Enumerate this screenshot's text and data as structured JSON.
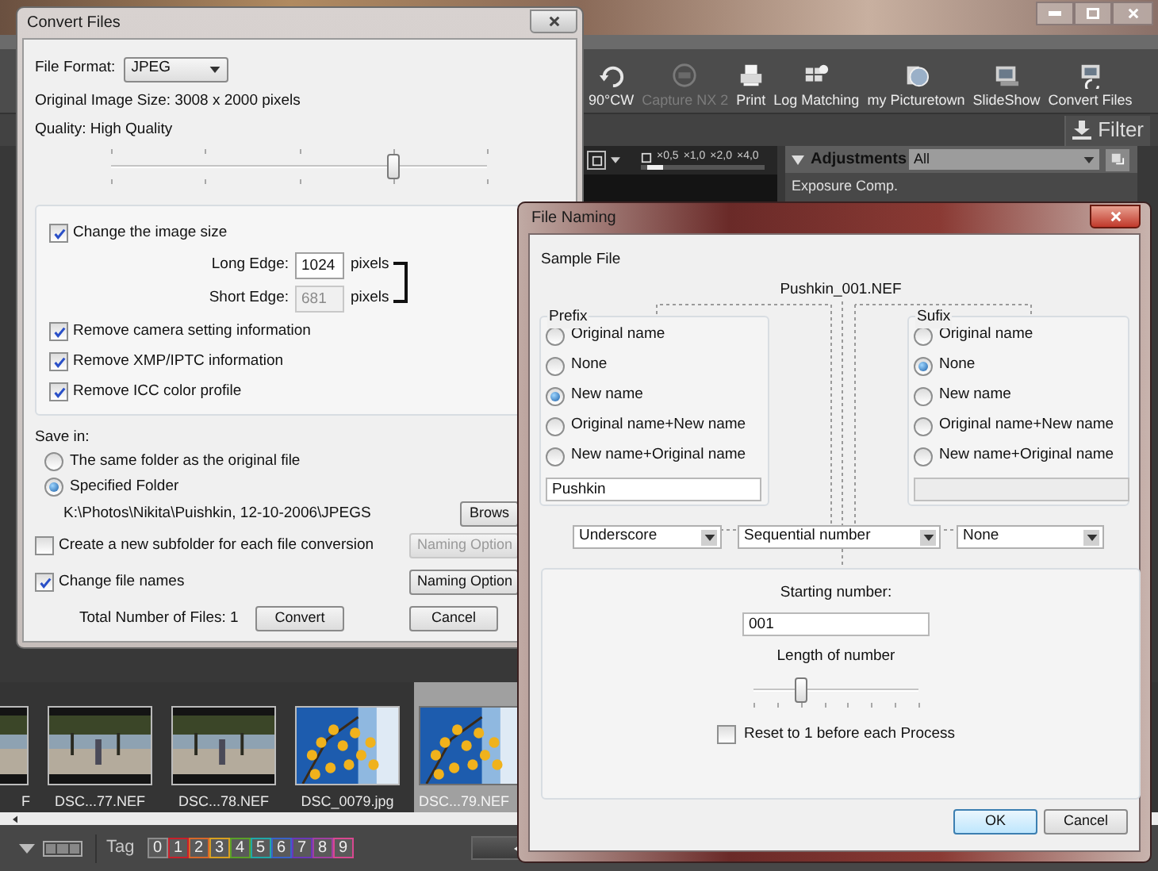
{
  "app": {
    "toolbar": [
      {
        "label": "90°CW",
        "disabled": false
      },
      {
        "label": "Capture NX 2",
        "disabled": true
      },
      {
        "label": "Print",
        "disabled": false
      },
      {
        "label": "Log Matching",
        "disabled": false
      },
      {
        "label": "my Picturetown",
        "disabled": false
      },
      {
        "label": "SlideShow",
        "disabled": false
      },
      {
        "label": "Convert Files",
        "disabled": false
      }
    ],
    "filter_button": "Filter",
    "zoom": {
      "labels": [
        "×0,5",
        "×1,0",
        "×2,0",
        "×4,0"
      ],
      "level": 0.05
    },
    "adjustments": {
      "title": "Adjustments",
      "filter": "All",
      "items": [
        "Exposure Comp."
      ]
    },
    "thumbnails": [
      {
        "caption": "F",
        "selected": false
      },
      {
        "caption": "DSC...77.NEF",
        "selected": false
      },
      {
        "caption": "DSC...78.NEF",
        "selected": false
      },
      {
        "caption": "DSC_0079.jpg",
        "selected": false
      },
      {
        "caption": "DSC...79.NEF",
        "selected": true
      }
    ],
    "tag_label": "Tag",
    "tags": [
      {
        "label": "0",
        "color": "#8c8c8c"
      },
      {
        "label": "1",
        "color": "#c8202a"
      },
      {
        "label": "2",
        "color": "#d8682a"
      },
      {
        "label": "3",
        "color": "#d8a020"
      },
      {
        "label": "4",
        "color": "#5aa028"
      },
      {
        "label": "5",
        "color": "#20a8a8"
      },
      {
        "label": "6",
        "color": "#3a62c8"
      },
      {
        "label": "7",
        "color": "#6a38b8"
      },
      {
        "label": "8",
        "color": "#a040a0"
      },
      {
        "label": "9",
        "color": "#d84890"
      }
    ]
  },
  "convert_files": {
    "title": "Convert Files",
    "file_format": {
      "label": "File Format:",
      "value": "JPEG"
    },
    "image_size": "Original Image Size: 3008 x 2000 pixels",
    "quality": {
      "label": "Quality: High Quality",
      "level": 0.75
    },
    "resize": {
      "label": "Change the image size",
      "checked": true,
      "long_edge": {
        "label": "Long Edge:",
        "value": "1024",
        "unit": "pixels",
        "disabled": false
      },
      "short_edge": {
        "label": "Short Edge:",
        "value": "681",
        "unit": "pixels",
        "disabled": true
      }
    },
    "options": [
      {
        "label": "Remove camera setting information",
        "checked": true
      },
      {
        "label": "Remove XMP/IPTC information",
        "checked": true
      },
      {
        "label": "Remove ICC color profile",
        "checked": true
      }
    ],
    "save_in": {
      "label": "Save in:",
      "choices": [
        {
          "label": "The same folder as the original file",
          "selected": false
        },
        {
          "label": "Specified Folder",
          "selected": true
        }
      ],
      "path": "K:\\Photos\\Nikita\\Puishkin, 12-10-2006\\JPEGS",
      "browse_button": "Brows"
    },
    "file_options": [
      {
        "label": "Create a new subfolder for each file conversion",
        "checked": false,
        "button": "Naming Option",
        "button_disabled": true
      },
      {
        "label": "Change file names",
        "checked": true,
        "button": "Naming Option",
        "button_disabled": false
      }
    ],
    "total_files": "Total Number of Files: 1",
    "buttons": [
      "Convert",
      "Cancel"
    ]
  },
  "file_naming": {
    "title": "File Naming",
    "sample_label": "Sample File",
    "sample_name": "Pushkin_001.NEF",
    "prefix": {
      "title": "Prefix",
      "options": [
        {
          "label": "Original name",
          "selected": false
        },
        {
          "label": "None",
          "selected": false
        },
        {
          "label": "New name",
          "selected": true
        },
        {
          "label": "Original name+New name",
          "selected": false
        },
        {
          "label": "New name+Original name",
          "selected": false
        }
      ],
      "text": "Pushkin",
      "disabled": false
    },
    "suffix": {
      "title": "Sufix",
      "options": [
        {
          "label": "Original name",
          "selected": false
        },
        {
          "label": "None",
          "selected": true
        },
        {
          "label": "New name",
          "selected": false
        },
        {
          "label": "Original name+New name",
          "selected": false
        },
        {
          "label": "New name+Original name",
          "selected": false
        }
      ],
      "disabled": true
    },
    "separators": [
      "Underscore",
      "Sequential number",
      "None"
    ],
    "starting_number": {
      "label": "Starting number:",
      "value": "001"
    },
    "length": {
      "label": "Length of number",
      "level": 0.29
    },
    "reset": {
      "label": "Reset to 1 before each Process",
      "checked": false
    },
    "buttons": [
      {
        "label": "OK",
        "default": true
      },
      {
        "label": "Cancel",
        "default": false
      }
    ]
  }
}
